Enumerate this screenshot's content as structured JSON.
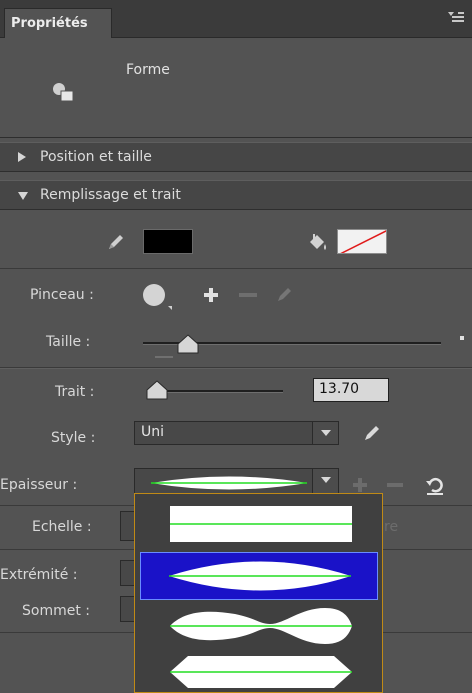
{
  "panel": {
    "tab_title": "Propriétés",
    "menu_icon": "panel-menu-icon"
  },
  "forme": {
    "icon": "shape-icon",
    "label": "Forme"
  },
  "sections": {
    "position_size": "Position et taille",
    "fill_stroke": "Remplissage et trait"
  },
  "fill_stroke": {
    "stroke_color": "#000000",
    "stroke_icon": "pencil-icon",
    "fill_icon": "paint-bucket-icon",
    "fill_color": "none"
  },
  "brush": {
    "label": "Pinceau :",
    "add_icon": "plus-icon",
    "remove_icon": "minus-icon",
    "edit_icon": "pencil-icon"
  },
  "size": {
    "label": "Taille :"
  },
  "stroke": {
    "label": "Trait :",
    "value": "13.70"
  },
  "style": {
    "label": "Style :",
    "value": "Uni"
  },
  "thickness": {
    "label": "Epaisseur :",
    "reset_icon": "reset-icon"
  },
  "scale": {
    "label": "Echelle :",
    "partial_text": "re"
  },
  "cap": {
    "label": "Extrémité :"
  },
  "join": {
    "label": "Sommet :"
  },
  "profile_options": [
    {
      "name": "uniform",
      "selected": false
    },
    {
      "name": "width-profile-1",
      "selected": true
    },
    {
      "name": "width-profile-2",
      "selected": false
    },
    {
      "name": "width-profile-3",
      "selected": false
    }
  ],
  "colors": {
    "panel_bg": "#535353",
    "selection": "#1a12c8",
    "popup_border": "#c08a16",
    "guide_line": "#22dd22"
  }
}
